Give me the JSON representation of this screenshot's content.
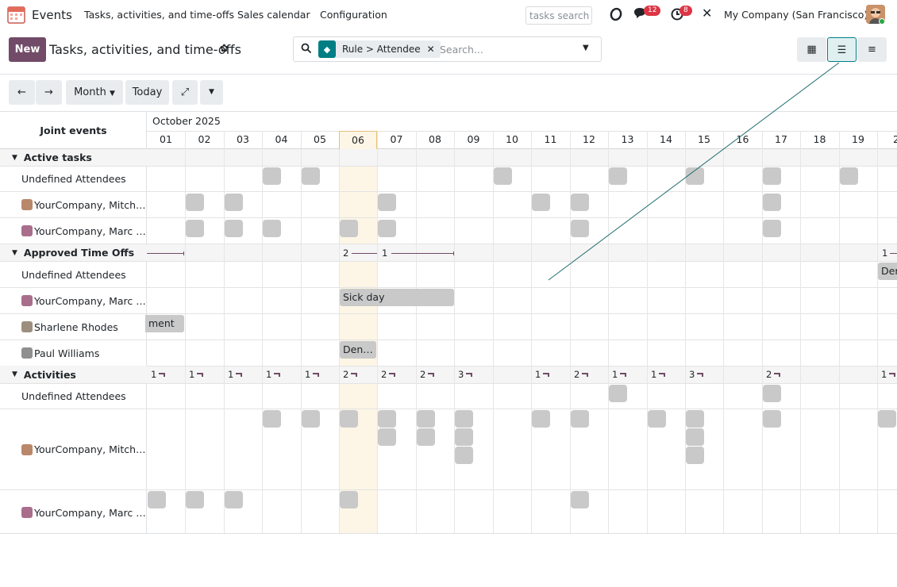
{
  "navbar": {
    "app_name": "Events",
    "menus": [
      "Tasks, activities, and time-offs",
      "Sales calendar",
      "Configuration"
    ],
    "search_placeholder": "tasks search",
    "messages_count": "12",
    "activities_count": "8",
    "company": "My Company (San Francisco)"
  },
  "control": {
    "new_label": "New",
    "title": "Tasks, activities, and time-offs",
    "facet_label": "Rule > Attendee",
    "search_placeholder": "Search..."
  },
  "toolbar": {
    "prev": "←",
    "next": "→",
    "scale": "Month",
    "today": "Today"
  },
  "grid": {
    "header_label": "Joint events",
    "month": "October 2025",
    "days": [
      "01",
      "02",
      "03",
      "04",
      "05",
      "06",
      "07",
      "08",
      "09",
      "10",
      "11",
      "12",
      "13",
      "14",
      "15",
      "16",
      "17",
      "18",
      "19",
      "2"
    ],
    "groups": {
      "tasks": "Active tasks",
      "timeoffs": "Approved Time Offs",
      "activities": "Activities"
    },
    "rows": {
      "undef": "Undefined Attendees",
      "mitch": "YourCompany, Mitch…",
      "marc": "YourCompany, Marc …",
      "sharlene": "Sharlene Rhodes",
      "paul": "Paul Williams"
    },
    "timeoff_counts": {
      "c1": "2",
      "c2": "1",
      "c3": "1"
    },
    "activity_counts": [
      "1",
      "1",
      "1",
      "1",
      "1",
      "2",
      "2",
      "2",
      "3",
      "1",
      "2",
      "1",
      "1",
      "3",
      "2",
      "1"
    ],
    "events": {
      "sick": "Sick day",
      "ment": "ment",
      "den1": "Den…",
      "den2": "Der"
    }
  },
  "colors": {
    "brand": "#714b67",
    "today_highlight": "#fdf6e6",
    "pill": "#c9c9c9",
    "accent_teal": "#017e84"
  }
}
